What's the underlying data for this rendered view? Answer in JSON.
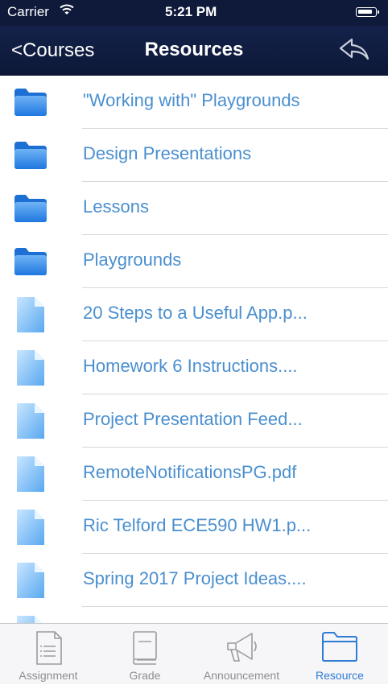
{
  "status_bar": {
    "carrier": "Carrier",
    "time": "5:21 PM"
  },
  "nav": {
    "back_label": "<Courses",
    "title": "Resources"
  },
  "items": [
    {
      "type": "folder",
      "name": "\"Working with\" Playgrounds"
    },
    {
      "type": "folder",
      "name": "Design Presentations"
    },
    {
      "type": "folder",
      "name": "Lessons"
    },
    {
      "type": "folder",
      "name": "Playgrounds"
    },
    {
      "type": "file",
      "name": "20 Steps to a Useful App.p..."
    },
    {
      "type": "file",
      "name": "Homework 6 Instructions...."
    },
    {
      "type": "file",
      "name": "Project Presentation Feed..."
    },
    {
      "type": "file",
      "name": "RemoteNotificationsPG.pdf"
    },
    {
      "type": "file",
      "name": "Ric Telford ECE590 HW1.p..."
    },
    {
      "type": "file",
      "name": "Spring 2017 Project Ideas...."
    },
    {
      "type": "file",
      "name": ""
    }
  ],
  "tabs": [
    {
      "label": "Assignment",
      "icon": "assignment-icon",
      "active": false
    },
    {
      "label": "Grade",
      "icon": "book-icon",
      "active": false
    },
    {
      "label": "Announcement",
      "icon": "megaphone-icon",
      "active": false
    },
    {
      "label": "Resource",
      "icon": "folder-icon",
      "active": true
    }
  ],
  "colors": {
    "nav_bg": "#0f1a3b",
    "link": "#4a8fcf",
    "active_tab": "#2f7cd6",
    "inactive_tab": "#8e8e93"
  }
}
